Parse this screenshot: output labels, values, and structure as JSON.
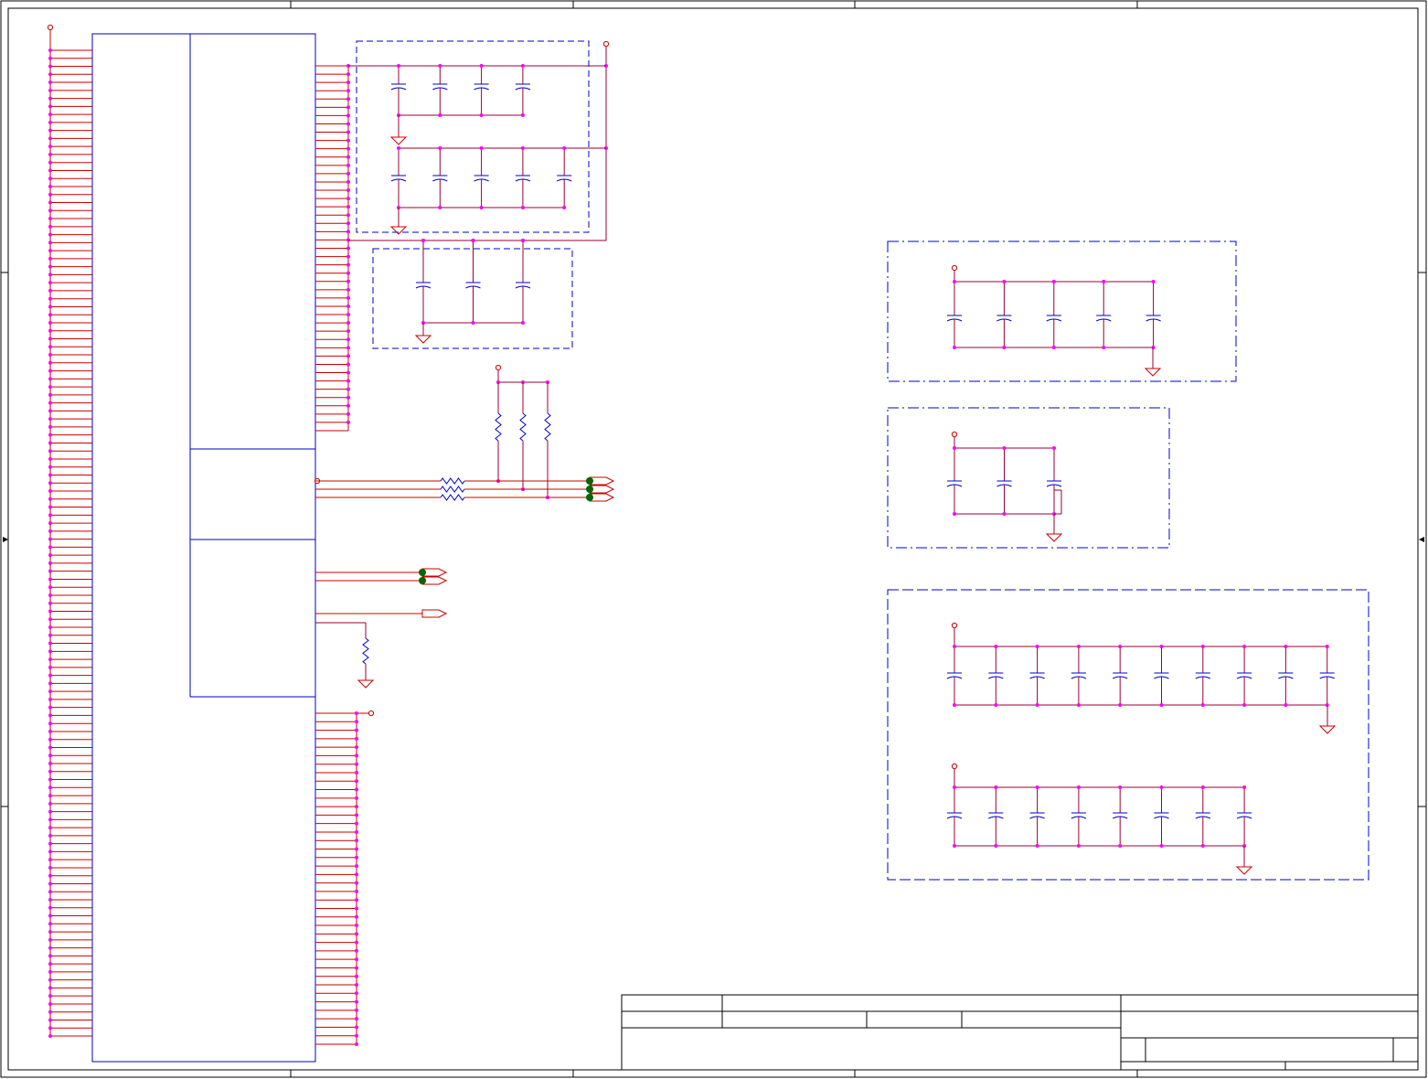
{
  "sheet": {
    "colors": {
      "border": "#000000",
      "component": "#0000cc",
      "wire": "#cc0000",
      "net": "#990033",
      "junction": "#ff00ff",
      "power_port": "#cc0000",
      "off_page_fill": "#006600"
    },
    "title_block": {
      "visible_text": ""
    }
  },
  "netlist": {
    "ic_left_pin_count": 124,
    "ic_right_top_pin_count": 45,
    "ic_right_bottom_pin_count": 40,
    "decoupling_groups": [
      {
        "name": "group-a-row-1",
        "capacitors": 4
      },
      {
        "name": "group-a-row-2",
        "capacitors": 5
      },
      {
        "name": "group-b",
        "capacitors": 3
      },
      {
        "name": "group-c",
        "capacitors": 5
      },
      {
        "name": "group-d",
        "capacitors": 3
      },
      {
        "name": "group-e-row-1",
        "capacitors": 10
      },
      {
        "name": "group-e-row-2",
        "capacitors": 8
      }
    ],
    "pullup_resistors": 3,
    "series_resistors": 3,
    "pulldown_resistors": 1,
    "off_page_connectors": {
      "green": 5,
      "open": 1
    }
  }
}
